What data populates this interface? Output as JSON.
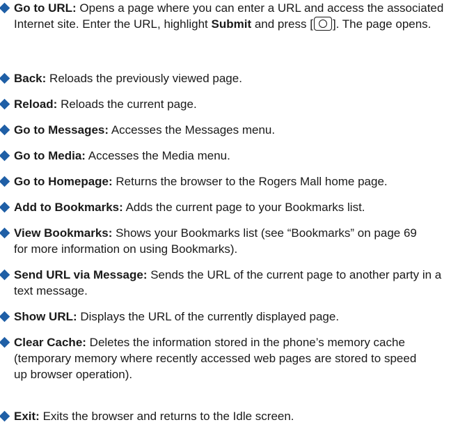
{
  "items": [
    {
      "term": "Go to URL:",
      "pre": " Opens a page where you can enter a URL and access the associated Internet site. Enter the URL, highlight ",
      "bold2": "Submit",
      "mid": " and press [",
      "key_icon": "center-select-key-icon",
      "post": "]. The page opens."
    },
    {
      "term": "Back:",
      "desc": " Reloads the previously viewed page."
    },
    {
      "term": "Reload:",
      "desc": " Reloads the current page."
    },
    {
      "term": "Go to Messages:",
      "desc": " Accesses the Messages menu."
    },
    {
      "term": "Go to Media:",
      "desc": " Accesses the Media menu."
    },
    {
      "term": "Go to Homepage:",
      "desc": " Returns the browser to the Rogers Mall home page."
    },
    {
      "term": "Add to Bookmarks:",
      "desc": " Adds the current page to your Bookmarks list."
    },
    {
      "term": "View Bookmarks:",
      "desc": " Shows your Bookmarks list (see “Bookmarks” on page 69 for more information on using Bookmarks)."
    },
    {
      "term": "Send URL via Message:",
      "desc": " Sends the URL of the current page to another party in a text message."
    },
    {
      "term": "Show URL:",
      "desc": " Displays the URL of the currently displayed page."
    },
    {
      "term": "Clear Cache:",
      "desc": " Deletes the information stored in the phone’s memory cache (temporary memory where recently accessed web pages are stored to speed up browser operation)."
    },
    {
      "term": "Exit:",
      "desc": " Exits the browser and returns to the Idle screen."
    }
  ],
  "colors": {
    "bullet": "#1f5fa6",
    "text": "#1a1a1a"
  },
  "icons": {
    "bullet": "diamond-bullet-icon"
  }
}
